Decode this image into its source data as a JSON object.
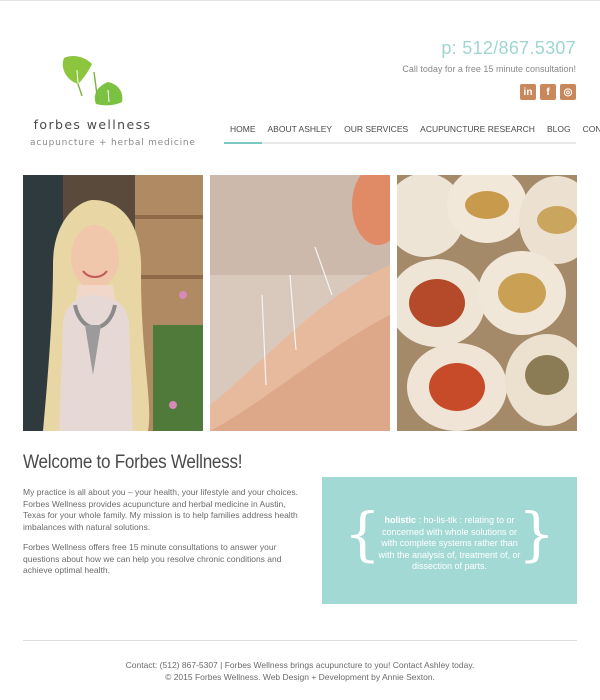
{
  "brand": {
    "name": "forbes wellness",
    "tagline": "acupuncture + herbal medicine"
  },
  "header": {
    "phone": "p: 512/867.5307",
    "cta": "Call today for a free 15 minute consultation!",
    "social": [
      {
        "name": "linkedin",
        "glyph": "in"
      },
      {
        "name": "facebook",
        "glyph": "f"
      },
      {
        "name": "instagram",
        "glyph": "◎"
      }
    ]
  },
  "nav": {
    "items": [
      {
        "label": "HOME",
        "active": true
      },
      {
        "label": "ABOUT ASHLEY",
        "active": false
      },
      {
        "label": "OUR SERVICES",
        "active": false
      },
      {
        "label": "ACUPUNCTURE RESEARCH",
        "active": false
      },
      {
        "label": "BLOG",
        "active": false
      },
      {
        "label": "CONTACT",
        "active": false
      }
    ]
  },
  "welcome": {
    "title": "Welcome to Forbes Wellness!",
    "para1": "My practice is all about you – your health, your lifestyle and your choices. Forbes Wellness provides acupuncture and herbal medicine in Austin, Texas for your whole family. My mission is to help families address health imbalances with natural solutions.",
    "para2": "Forbes Wellness offers free 15 minute consultations to answer your questions about how we can help you resolve chronic conditions and achieve optimal health."
  },
  "definition": {
    "term": "holistic",
    "body": ": ho-lis-tik : relating to or concerned with whole solutions or with complete systems rather than with the analysis of, treatment of, or dissection of parts."
  },
  "footer": {
    "line1": "Contact: (512) 867-5307 | Forbes Wellness brings acupuncture to you! Contact Ashley today.",
    "line2": "© 2015 Forbes Wellness. Web Design + Development by Annie Sexton."
  },
  "colors": {
    "accent": "#9fd6d2",
    "box": "#a3d9d5",
    "social": "#c9875c",
    "logo_green": "#7cc242"
  }
}
